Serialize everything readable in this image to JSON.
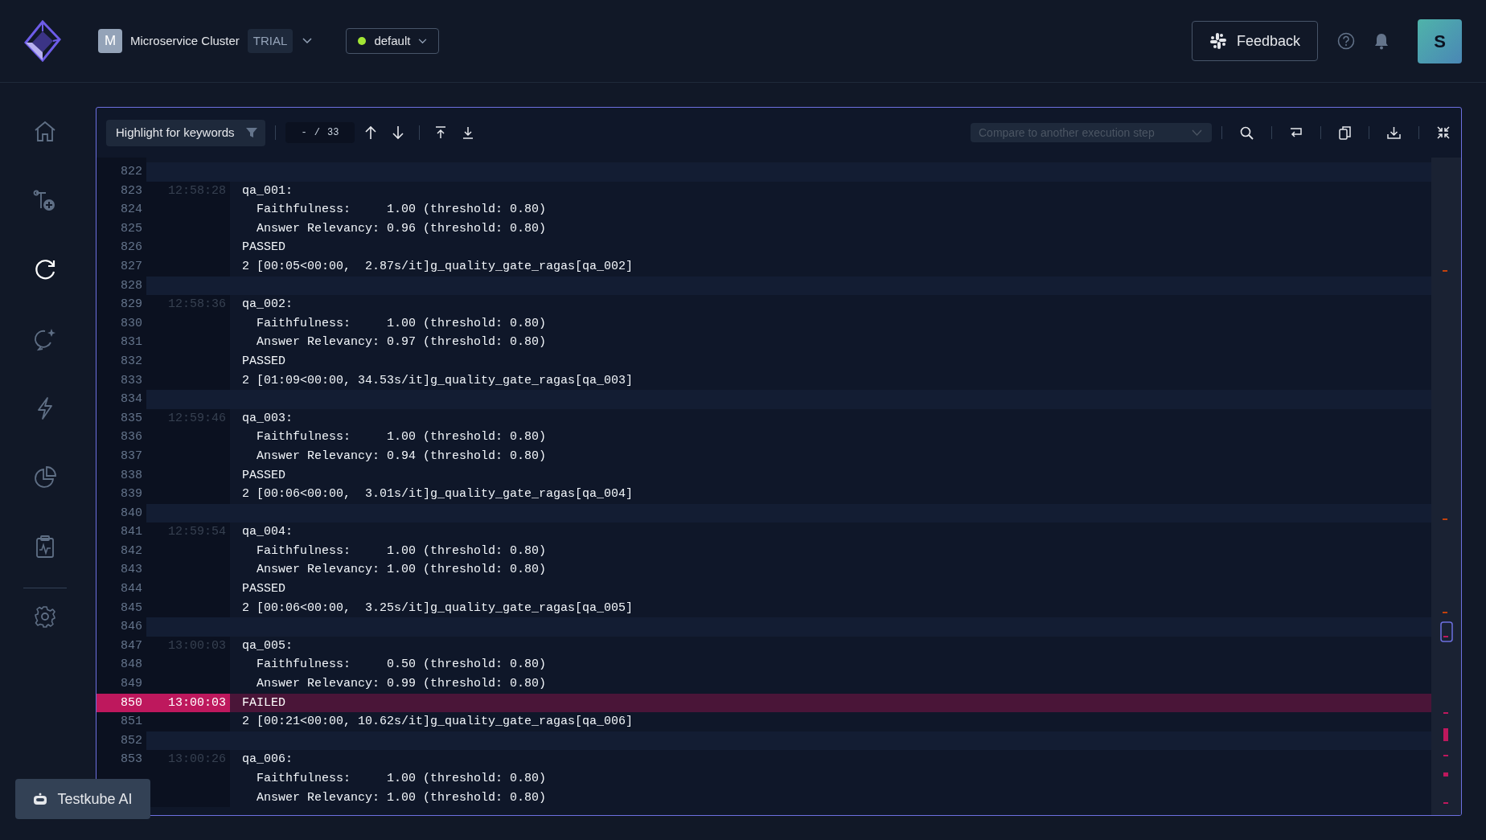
{
  "header": {
    "org": {
      "initial": "M",
      "name": "Microservice Cluster",
      "badge": "TRIAL"
    },
    "environment": {
      "name": "default",
      "color": "#a3e635"
    },
    "feedback": "Feedback",
    "user_initial": "S"
  },
  "sidebar": {
    "main": [
      {
        "kind": "home",
        "selected": false
      },
      {
        "kind": "flow",
        "selected": false
      },
      {
        "kind": "refresh",
        "selected": true
      },
      {
        "kind": "refresh-spark",
        "selected": false
      },
      {
        "kind": "bolt",
        "selected": false
      },
      {
        "kind": "pie",
        "selected": false
      },
      {
        "kind": "clipboard",
        "selected": false
      }
    ],
    "bottom": [
      {
        "kind": "gear",
        "selected": false
      }
    ]
  },
  "toolbar": {
    "highlight": "Highlight for keywords",
    "counter_current": "-",
    "counter_sep": "/",
    "counter_total": "33",
    "compare_placeholder": "Compare to another execution step"
  },
  "lines": [
    {
      "num": "822",
      "kind": "blank"
    },
    {
      "num": "823",
      "time": "12:58:28",
      "text": "qa_001:",
      "kind": "start"
    },
    {
      "num": "824",
      "text": "  Faithfulness:     1.00 (threshold: 0.80)",
      "kind": "text"
    },
    {
      "num": "825",
      "text": "  Answer Relevancy: 0.96 (threshold: 0.80)",
      "kind": "text"
    },
    {
      "num": "826",
      "text": "PASSED",
      "kind": "text"
    },
    {
      "num": "827",
      "text": "2 [00:05<00:00,  2.87s/it]g_quality_gate_ragas[qa_002]",
      "kind": "text"
    },
    {
      "num": "828",
      "kind": "blank"
    },
    {
      "num": "829",
      "time": "12:58:36",
      "text": "qa_002:",
      "kind": "start"
    },
    {
      "num": "830",
      "text": "  Faithfulness:     1.00 (threshold: 0.80)",
      "kind": "text"
    },
    {
      "num": "831",
      "text": "  Answer Relevancy: 0.97 (threshold: 0.80)",
      "kind": "text"
    },
    {
      "num": "832",
      "text": "PASSED",
      "kind": "text"
    },
    {
      "num": "833",
      "text": "2 [01:09<00:00, 34.53s/it]g_quality_gate_ragas[qa_003]",
      "kind": "text"
    },
    {
      "num": "834",
      "kind": "blank"
    },
    {
      "num": "835",
      "time": "12:59:46",
      "text": "qa_003:",
      "kind": "start"
    },
    {
      "num": "836",
      "text": "  Faithfulness:     1.00 (threshold: 0.80)",
      "kind": "text"
    },
    {
      "num": "837",
      "text": "  Answer Relevancy: 0.94 (threshold: 0.80)",
      "kind": "text"
    },
    {
      "num": "838",
      "text": "PASSED",
      "kind": "text"
    },
    {
      "num": "839",
      "text": "2 [00:06<00:00,  3.01s/it]g_quality_gate_ragas[qa_004]",
      "kind": "text"
    },
    {
      "num": "840",
      "kind": "blank"
    },
    {
      "num": "841",
      "time": "12:59:54",
      "text": "qa_004:",
      "kind": "start"
    },
    {
      "num": "842",
      "text": "  Faithfulness:     1.00 (threshold: 0.80)",
      "kind": "text"
    },
    {
      "num": "843",
      "text": "  Answer Relevancy: 1.00 (threshold: 0.80)",
      "kind": "text"
    },
    {
      "num": "844",
      "text": "PASSED",
      "kind": "text"
    },
    {
      "num": "845",
      "text": "2 [00:06<00:00,  3.25s/it]g_quality_gate_ragas[qa_005]",
      "kind": "text"
    },
    {
      "num": "846",
      "kind": "blank"
    },
    {
      "num": "847",
      "time": "13:00:03",
      "text": "qa_005:",
      "kind": "start"
    },
    {
      "num": "848",
      "text": "  Faithfulness:     0.50 (threshold: 0.80)",
      "kind": "text"
    },
    {
      "num": "849",
      "text": "  Answer Relevancy: 0.99 (threshold: 0.80)",
      "kind": "text"
    },
    {
      "num": "850",
      "time": "13:00:03",
      "text": "FAILED",
      "kind": "error"
    },
    {
      "num": "851",
      "text": "2 [00:21<00:00, 10.62s/it]g_quality_gate_ragas[qa_006]",
      "kind": "text"
    },
    {
      "num": "852",
      "kind": "blank"
    },
    {
      "num": "853",
      "time": "13:00:26",
      "text": "qa_006:",
      "kind": "start"
    },
    {
      "text": "  Faithfulness:     1.00 (threshold: 0.80)",
      "kind": "text"
    },
    {
      "text": "  Answer Relevancy: 1.00 (threshold: 0.80)",
      "kind": "text"
    }
  ],
  "assistant_button": "Testkube AI"
}
